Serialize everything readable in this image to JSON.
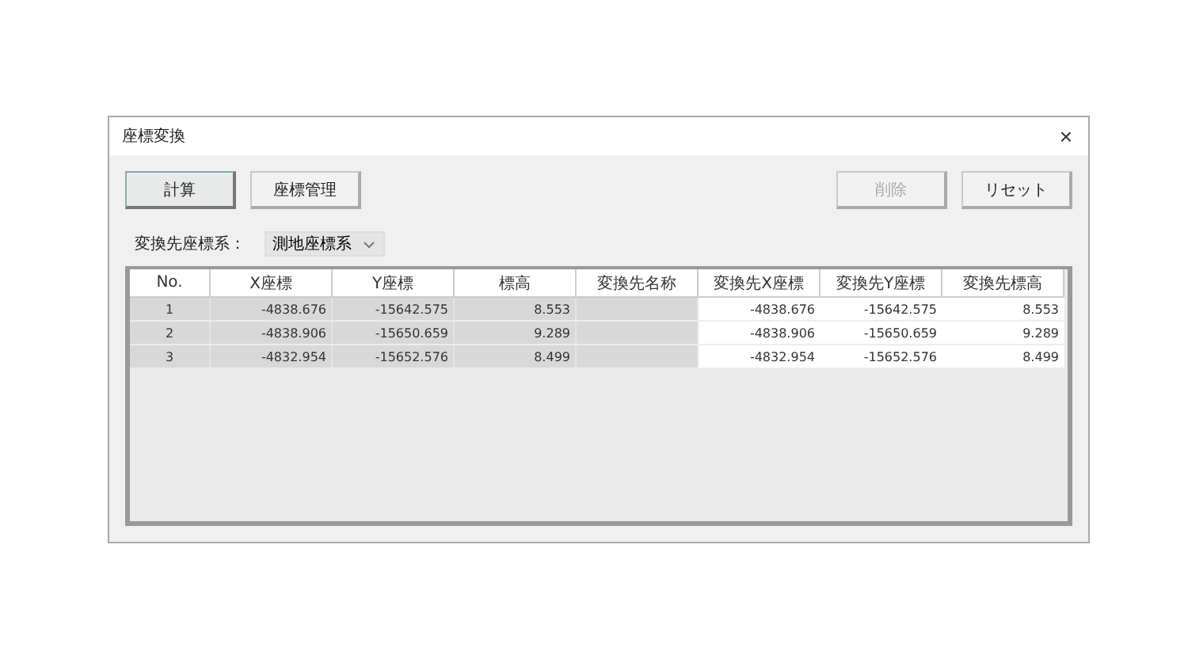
{
  "window": {
    "title": "座標変換",
    "close": "×"
  },
  "toolbar": {
    "left": [
      {
        "label": "計算",
        "disabled": false,
        "selected": true
      },
      {
        "label": "座標管理",
        "disabled": false,
        "selected": false
      }
    ],
    "right": [
      {
        "label": "削除",
        "disabled": true,
        "selected": false
      },
      {
        "label": "リセット",
        "disabled": false,
        "selected": false
      }
    ]
  },
  "target_system": {
    "label": "変換先座標系：",
    "value": "測地座標系"
  },
  "table": {
    "columns": [
      {
        "label": "No.",
        "readonly": true
      },
      {
        "label": "X座標",
        "readonly": true
      },
      {
        "label": "Y座標",
        "readonly": true
      },
      {
        "label": "標高",
        "readonly": true
      },
      {
        "label": "変換先名称",
        "readonly": true
      },
      {
        "label": "変換先X座標",
        "readonly": false
      },
      {
        "label": "変換先Y座標",
        "readonly": false
      },
      {
        "label": "変換先標高",
        "readonly": false
      }
    ],
    "rows": [
      {
        "cells": [
          "1",
          "-4838.676",
          "-15642.575",
          "8.553",
          null,
          "-4838.676",
          "-15642.575",
          "8.553"
        ]
      },
      {
        "cells": [
          "2",
          "-4838.906",
          "-15650.659",
          "9.289",
          null,
          "-4838.906",
          "-15650.659",
          "9.289"
        ]
      },
      {
        "cells": [
          "3",
          "-4832.954",
          "-15652.576",
          "8.499",
          null,
          "-4832.954",
          "-15652.576",
          "8.499"
        ]
      }
    ]
  }
}
